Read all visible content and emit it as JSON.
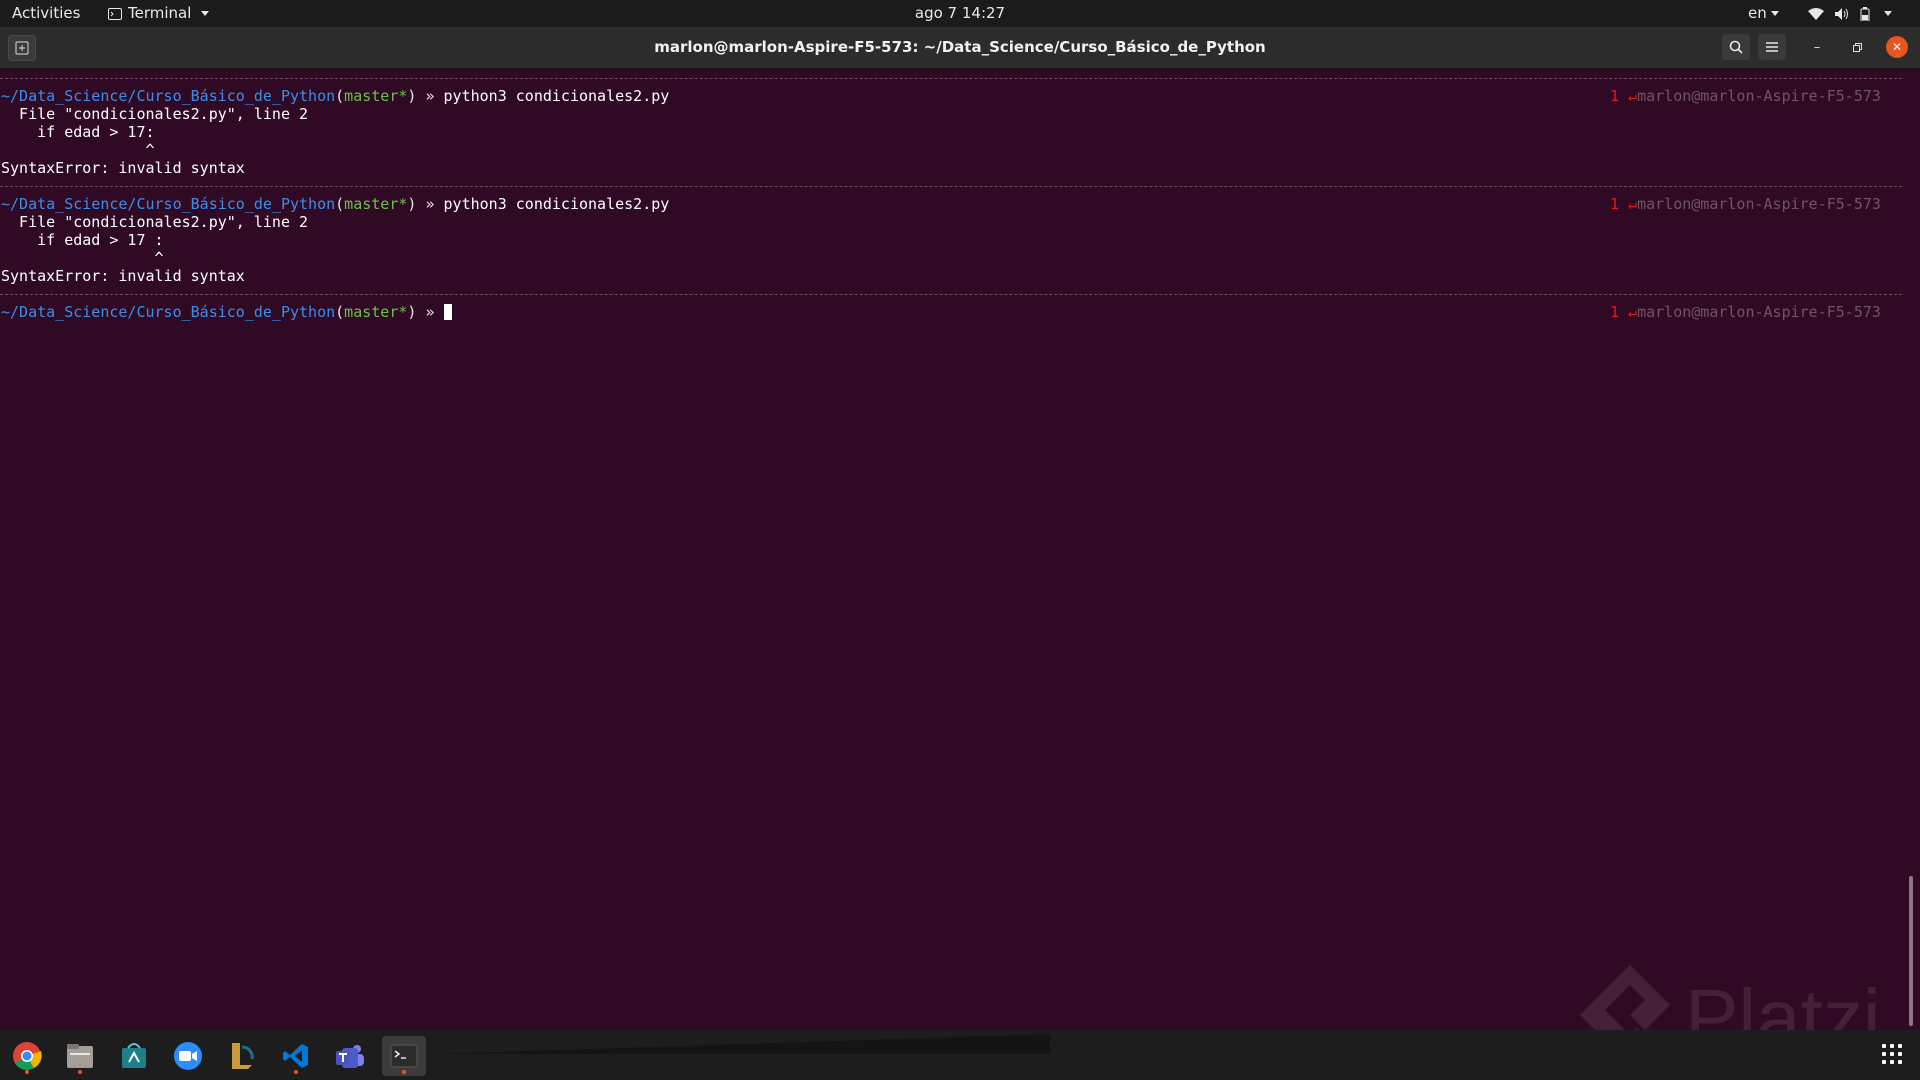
{
  "topbar": {
    "activities": "Activities",
    "app_menu": "Terminal",
    "clock": "ago 7  14:27",
    "language": "en"
  },
  "window": {
    "title": "marlon@marlon-Aspire-F5-573: ~/Data_Science/Curso_Básico_de_Python"
  },
  "terminal": {
    "blocks": [
      {
        "prompt": {
          "path": "~/Data_Science/Curso_Básico_de_Python",
          "open": "(",
          "branch": "master*",
          "close": ")",
          "arrow": " » ",
          "command": "python3 condicionales2.py"
        },
        "rprompt": {
          "exit_code": "1",
          "arrow": "↵",
          "host": "marlon@marlon-Aspire-F5-573"
        },
        "output": [
          "  File \"condicionales2.py\", line 2",
          "    if edad > 17:",
          "                ^",
          "SyntaxError: invalid syntax"
        ]
      },
      {
        "prompt": {
          "path": "~/Data_Science/Curso_Básico_de_Python",
          "open": "(",
          "branch": "master*",
          "close": ")",
          "arrow": " » ",
          "command": "python3 condicionales2.py"
        },
        "rprompt": {
          "exit_code": "1",
          "arrow": "↵",
          "host": "marlon@marlon-Aspire-F5-573"
        },
        "output": [
          "  File \"condicionales2.py\", line 2",
          "    if edad > 17 :",
          "                 ^",
          "SyntaxError: invalid syntax"
        ]
      },
      {
        "prompt": {
          "path": "~/Data_Science/Curso_Básico_de_Python",
          "open": "(",
          "branch": "master*",
          "close": ")",
          "arrow": " » ",
          "command": ""
        },
        "rprompt": {
          "exit_code": "1",
          "arrow": "↵",
          "host": "marlon@marlon-Aspire-F5-573"
        }
      }
    ]
  },
  "watermark": {
    "text": "Platzi"
  },
  "dock": {
    "items": [
      {
        "name": "chrome-icon",
        "running": true
      },
      {
        "name": "files-icon",
        "running": true
      },
      {
        "name": "app-store-icon",
        "running": false
      },
      {
        "name": "zoom-icon",
        "running": false
      },
      {
        "name": "league-client-icon",
        "running": false
      },
      {
        "name": "vscode-icon",
        "running": true
      },
      {
        "name": "teams-icon",
        "running": false
      },
      {
        "name": "terminal-icon",
        "running": true
      }
    ]
  },
  "colors": {
    "terminal_bg": "#300a24",
    "path": "#3b8eea",
    "branch": "#6bc04b",
    "exit_code": "#e01b24",
    "accent": "#e95420"
  }
}
